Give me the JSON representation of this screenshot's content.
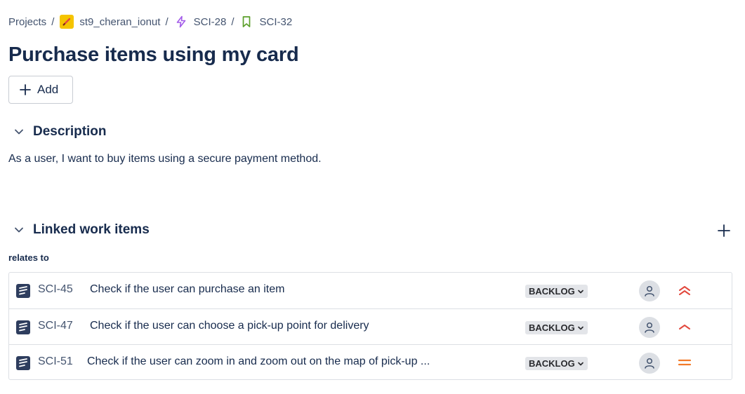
{
  "breadcrumb": {
    "projects": "Projects",
    "project": "st9_cheran_ionut",
    "epic": "SCI-28",
    "story": "SCI-32",
    "separator": "/"
  },
  "issue": {
    "title": "Purchase items using my card",
    "add_label": "Add"
  },
  "description": {
    "heading": "Description",
    "text": "As a user, I want to buy items using a secure payment method."
  },
  "linked": {
    "heading": "Linked work items",
    "relation": "relates to",
    "items": [
      {
        "key": "SCI-45",
        "summary": "Check if the user can purchase an item",
        "status": "BACKLOG",
        "priority": "highest",
        "priority_color": "#e2483d"
      },
      {
        "key": "SCI-47",
        "summary": "Check if the user can choose a pick-up point for delivery",
        "status": "BACKLOG",
        "priority": "high",
        "priority_color": "#e2483d"
      },
      {
        "key": "SCI-51",
        "summary": "Check if the user can zoom in and zoom out on the map of pick-up ...",
        "status": "BACKLOG",
        "priority": "medium",
        "priority_color": "#f27b2a"
      }
    ]
  },
  "icons": {
    "project": "project-avatar-icon",
    "epic": "lightning-icon",
    "story": "bookmark-icon",
    "add": "plus-icon",
    "collapse": "chevron-down-icon",
    "work_item": "test-icon",
    "assignee": "user-icon",
    "status_dropdown": "chevron-down-icon"
  },
  "colors": {
    "epic_purple": "#a35ce9",
    "story_green": "#5b9f2a",
    "project_yellow": "#f5c400",
    "text": "#172b4d",
    "status_bg": "#e3e5e9"
  }
}
